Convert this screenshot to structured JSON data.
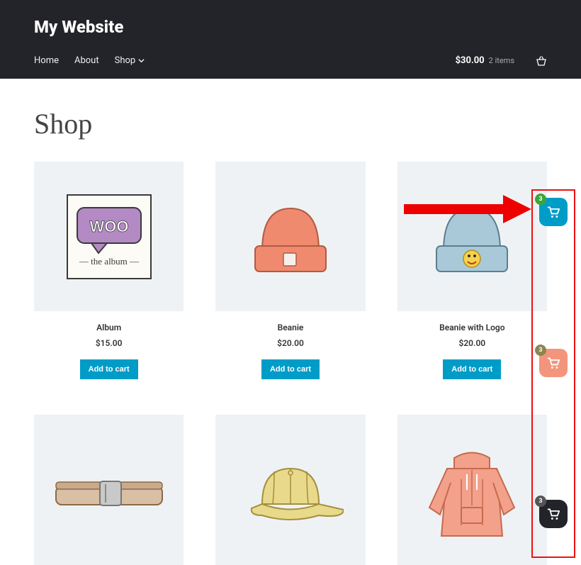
{
  "header": {
    "site_title": "My Website",
    "nav": {
      "home": "Home",
      "about": "About",
      "shop": "Shop"
    },
    "cart": {
      "total": "$30.00",
      "items_label": "2 items"
    }
  },
  "page": {
    "title": "Shop"
  },
  "products": [
    {
      "name": "Album",
      "price": "$15.00",
      "cta": "Add to cart"
    },
    {
      "name": "Beanie",
      "price": "$20.00",
      "cta": "Add to cart"
    },
    {
      "name": "Beanie with Logo",
      "price": "$20.00",
      "cta": "Add to cart"
    },
    {
      "name": "",
      "price": "",
      "cta": ""
    },
    {
      "name": "",
      "price": "",
      "cta": ""
    },
    {
      "name": "",
      "price": "",
      "cta": ""
    }
  ],
  "float_widgets": [
    {
      "badge": "3",
      "color_name": "teal"
    },
    {
      "badge": "3",
      "color_name": "coral"
    },
    {
      "badge": "3",
      "color_name": "dark"
    }
  ],
  "colors": {
    "header_bg": "#23232a",
    "accent": "#009cc8",
    "annotation_red": "#e11",
    "badge_green": "#3aa63a"
  }
}
